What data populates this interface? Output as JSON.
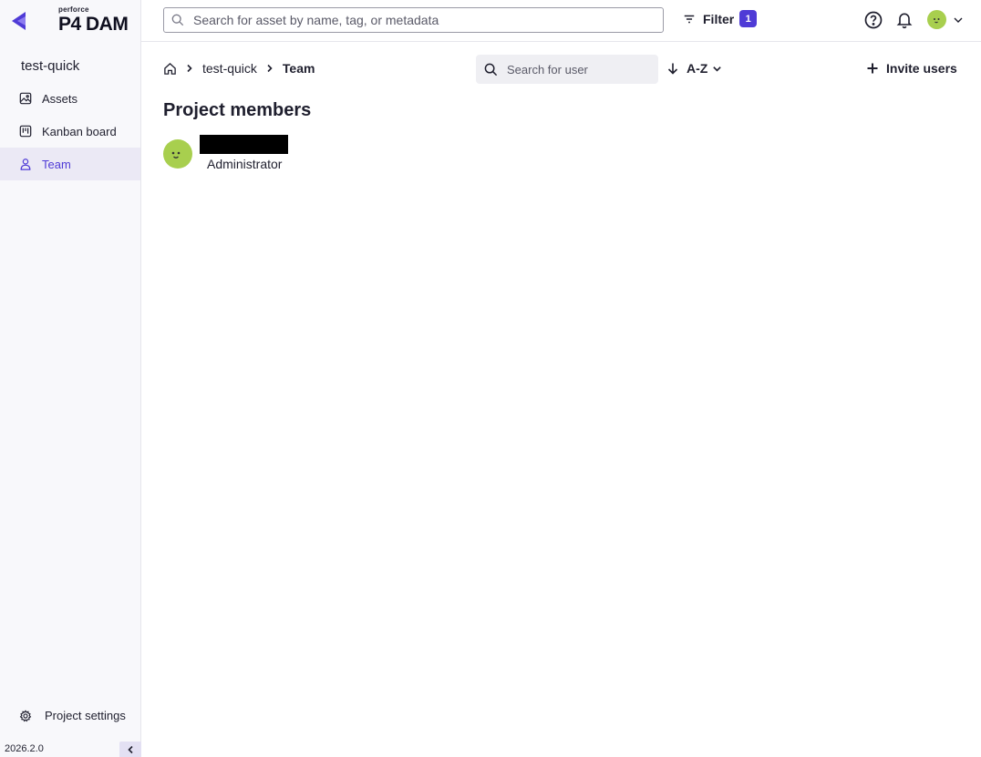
{
  "app": {
    "logo_small": "perforce",
    "logo_big": "P4 DAM",
    "version": "2026.2.0"
  },
  "sidebar": {
    "project_name": "test-quick",
    "items": [
      {
        "label": "Assets",
        "icon": "image-icon",
        "active": false
      },
      {
        "label": "Kanban board",
        "icon": "kanban-icon",
        "active": false
      },
      {
        "label": "Team",
        "icon": "user-icon",
        "active": true
      }
    ],
    "settings_label": "Project settings"
  },
  "header": {
    "search_placeholder": "Search for asset by name, tag, or metadata",
    "filter_label": "Filter",
    "filter_count": "1"
  },
  "main": {
    "breadcrumb": {
      "project": "test-quick",
      "current": "Team"
    },
    "user_search_placeholder": "Search for user",
    "sort_label": "A-Z",
    "invite_label": "Invite users",
    "title": "Project members",
    "members": [
      {
        "role": "Administrator"
      }
    ]
  },
  "colors": {
    "accent": "#4f3bd6",
    "avatar": "#a8cf4e",
    "sidebar_bg": "#f8f8fb",
    "active_bg": "#ebe9f5"
  }
}
